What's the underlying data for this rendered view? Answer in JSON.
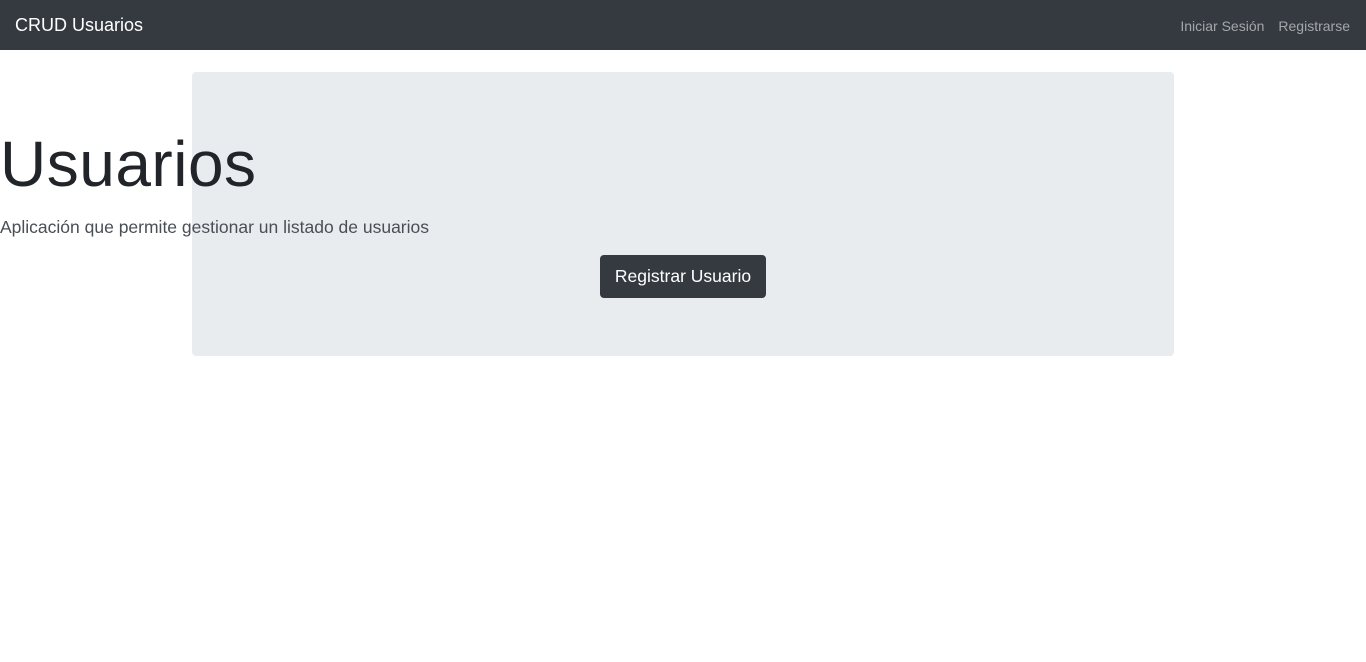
{
  "navbar": {
    "brand": "CRUD Usuarios",
    "links": [
      "Iniciar Sesión",
      "Registrarse"
    ],
    "background": "#343a40"
  },
  "hero": {
    "title": "Usuarios",
    "subtitle": "Aplicación que permite gestionar un listado de usuarios",
    "button_label": "Registrar Usuario",
    "background": "#e9ecef"
  }
}
